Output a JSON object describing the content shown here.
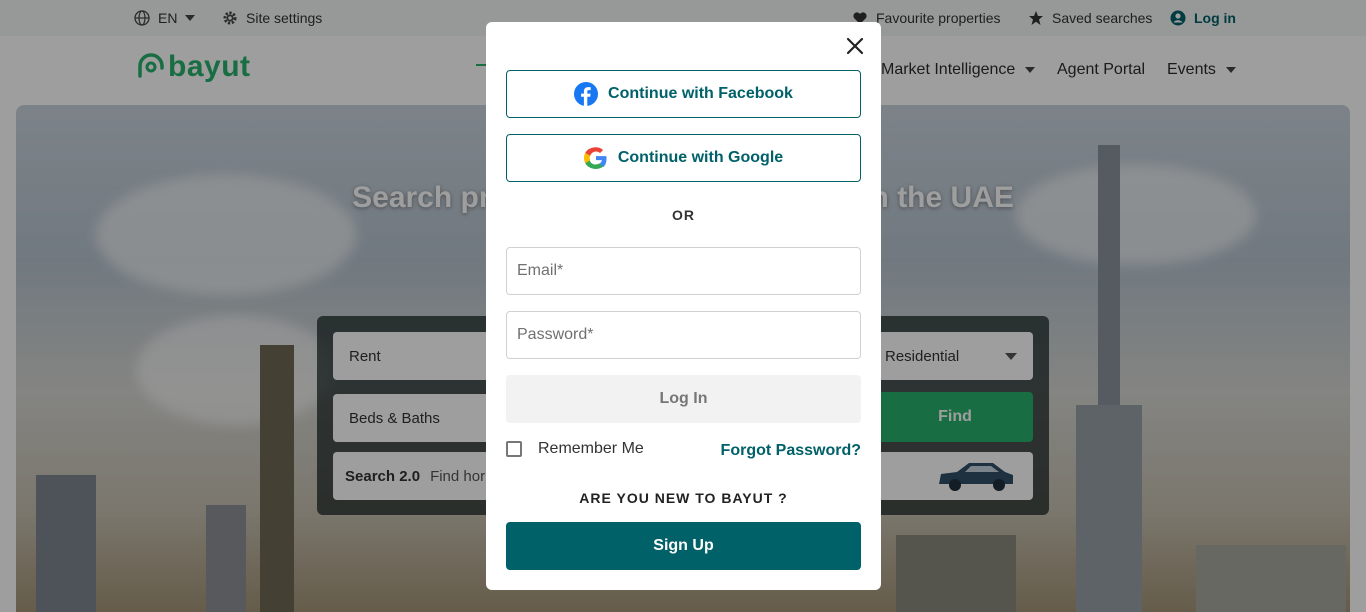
{
  "topbar": {
    "lang": "EN",
    "site_settings": "Site settings",
    "favourites": "Favourite properties",
    "saved_searches": "Saved searches",
    "login": "Log in"
  },
  "header": {
    "logo_text": "bayut",
    "nav": {
      "market_intelligence": "Market Intelligence",
      "agent_portal": "Agent Portal",
      "events": "Events"
    }
  },
  "hero": {
    "title_left": "Search pr",
    "title_right": "n the UAE"
  },
  "search": {
    "purpose": "Rent",
    "beds_baths": "Beds & Baths",
    "category": "Residential",
    "find": "Find",
    "search2_label": "Search 2.0",
    "search2_hint": "Find hor"
  },
  "modal": {
    "facebook": "Continue with Facebook",
    "google": "Continue with Google",
    "or": "OR",
    "email_placeholder": "Email*",
    "password_placeholder": "Password*",
    "login_button": "Log In",
    "remember_me": "Remember Me",
    "forgot_password": "Forgot Password?",
    "new_to": "ARE YOU NEW TO BAYUT ?",
    "signup": "Sign Up"
  },
  "colors": {
    "brand_green": "#28b16d",
    "brand_teal": "#006169",
    "facebook_blue": "#1877f2"
  }
}
